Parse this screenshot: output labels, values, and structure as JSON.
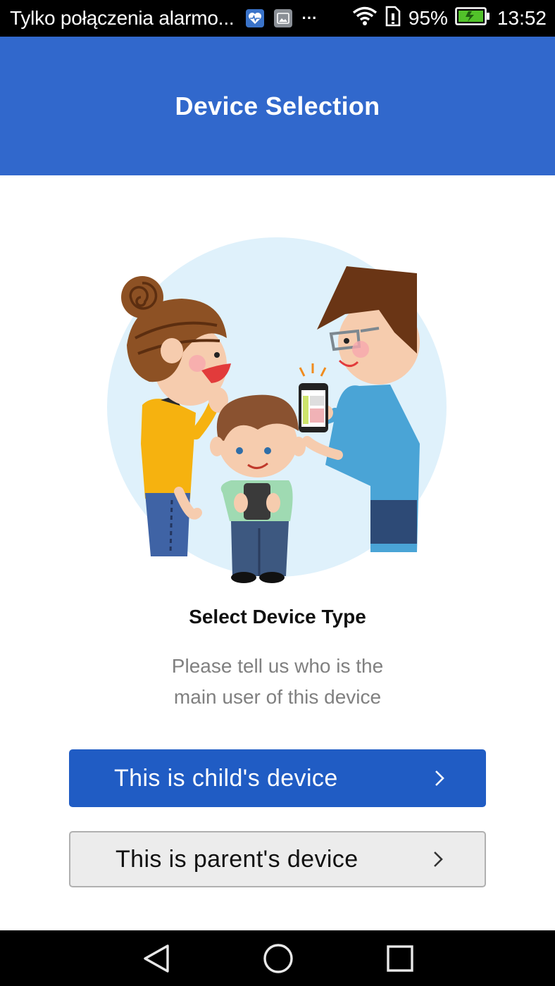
{
  "status_bar": {
    "notification_text": "Tylko połączenia alarmo...",
    "overflow": "···",
    "battery_percent": "95%",
    "time": "13:52"
  },
  "app_bar": {
    "title": "Device Selection"
  },
  "content": {
    "heading": "Select Device Type",
    "subtitle_line1": "Please tell us who is the",
    "subtitle_line2": "main user of this device"
  },
  "buttons": {
    "child": "This is child's device",
    "parent": "This is parent's device"
  },
  "colors": {
    "app_bar": "#3168cc",
    "primary_button": "#205cc4",
    "secondary_button": "#ececec"
  },
  "icons": {
    "status": [
      "health-app-icon",
      "gallery-icon",
      "wifi-icon",
      "sim-icon",
      "battery-icon"
    ],
    "buttons": [
      "chevron-right-icon"
    ],
    "nav": [
      "back-icon",
      "home-icon",
      "recents-icon"
    ]
  }
}
